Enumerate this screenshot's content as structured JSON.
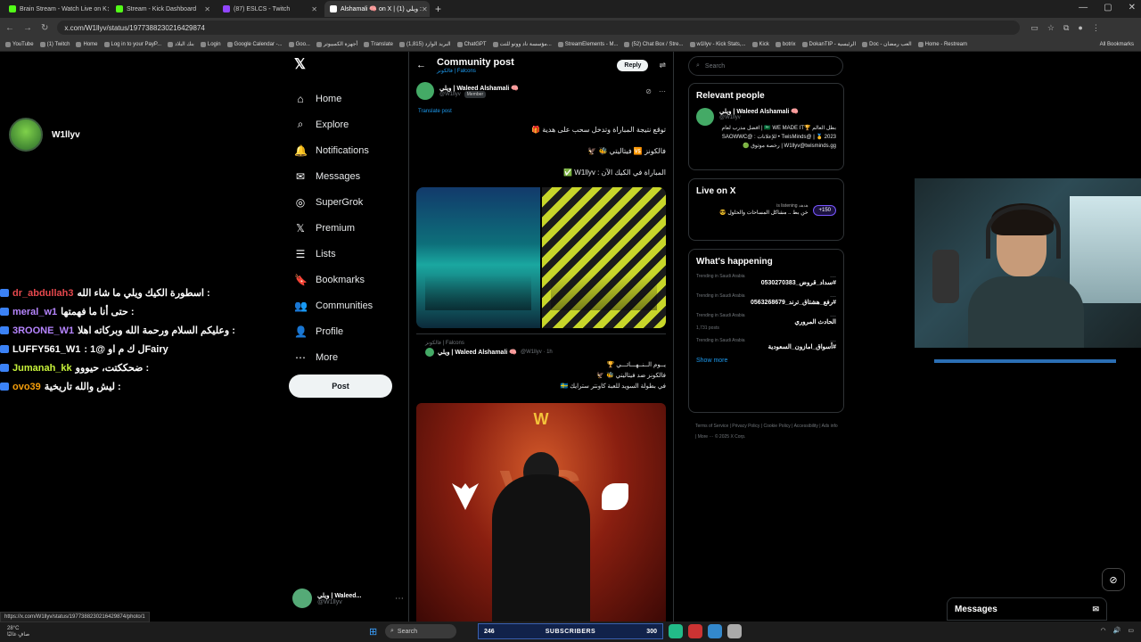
{
  "browser": {
    "tabs": [
      {
        "label": "Brain Stream - Watch Live on K",
        "color": "#53fc18"
      },
      {
        "label": "Stream - Kick Dashboard",
        "color": "#53fc18"
      },
      {
        "label": "(87) ESLCS - Twitch",
        "color": "#9146ff"
      },
      {
        "label": "Alshamali 🧠 on X | ويلي (1) :",
        "color": "#ffffff"
      }
    ],
    "url": "x.com/W1llyv/status/1977388230216429874",
    "bookmarks": [
      "YouTube",
      "(1) Twitch",
      "Home",
      "Log in to your PayP...",
      "بنك البلاد",
      "Login",
      "Google Calendar -...",
      "Goo...",
      "أجهزة الكمبيوتر",
      "Translate",
      "البريد الوارد (1,815)",
      "ChatGPT",
      "مؤسسة ناد ووتو للتت...",
      "StreamElements - M...",
      "(52) Chat Box / Stre...",
      "w1llyv - Kick Stats,...",
      "Kick",
      "botrix",
      "DokanTIP - الرئيسية",
      "Doc - العب رمضان",
      "Home - Restream"
    ],
    "all_bookmarks": "All Bookmarks"
  },
  "stream": {
    "streamer_name": "W1llyv",
    "chat": [
      {
        "user": "dr_abdullah3",
        "user_color": "#e5484d",
        "msg": "اسطورة الكيك ويلي ما شاء الله :"
      },
      {
        "user": "meral_w1",
        "user_color": "#b685ff",
        "msg": "حتى أنا ما فهمتها :"
      },
      {
        "user": "3ROONE_W1",
        "user_color": "#b685ff",
        "msg": "وعليكم السلام ورحمة الله وبركاته اهلا :"
      },
      {
        "user": "LUFFY561_W1",
        "user_color": "#ffffff",
        "msg": ": 1@ ل ك م اوFairy"
      },
      {
        "user": "Jumanah_kk",
        "user_color": "#c7f23a",
        "msg": "ضحككتت، حيووو :"
      },
      {
        "user": "ovo39",
        "user_color": "#f59e0b",
        "msg": "ليش والله تاريخية :"
      }
    ],
    "webcam_caption": ""
  },
  "x": {
    "nav": [
      {
        "label": "Home",
        "icon": "home-icon",
        "glyph": "⌂"
      },
      {
        "label": "Explore",
        "icon": "search-icon",
        "glyph": "⌕"
      },
      {
        "label": "Notifications",
        "icon": "bell-icon",
        "glyph": "🔔"
      },
      {
        "label": "Messages",
        "icon": "mail-icon",
        "glyph": "✉"
      },
      {
        "label": "SuperGrok",
        "icon": "grok-icon",
        "glyph": "◎"
      },
      {
        "label": "Premium",
        "icon": "x-icon",
        "glyph": "𝕏"
      },
      {
        "label": "Lists",
        "icon": "list-icon",
        "glyph": "☰"
      },
      {
        "label": "Bookmarks",
        "icon": "bookmark-icon",
        "glyph": "🔖"
      },
      {
        "label": "Communities",
        "icon": "people-icon",
        "glyph": "👥"
      },
      {
        "label": "Profile",
        "icon": "person-icon",
        "glyph": "👤"
      },
      {
        "label": "More",
        "icon": "more-icon",
        "glyph": "⋯"
      }
    ],
    "post_button": "Post",
    "account": {
      "name": "ويلي | Waleed...",
      "handle": "@W1llyv"
    },
    "header": {
      "title": "Community post",
      "subtitle": "فالكونز | Falcons",
      "reply": "Reply"
    },
    "post": {
      "author": "ويلي | Waleed Alshamali 🧠",
      "handle": "@W1llyv",
      "member": "Member",
      "translate": "Translate post",
      "lines": [
        "توقع نتيجة المباراة وتدخل سحب على هدية 🎁",
        "فالكونز 🆚 فيتاليتي 🐝 🦅",
        "المباراة في الكيك الآن : W1llyv ✅"
      ]
    },
    "quote": {
      "community": "فالكونز | Falcons",
      "author": "ويلي | Waleed Alshamali 🧠",
      "handle": "@W1llyv · 1h",
      "lines": [
        "يــوم الــنــهـــائـــي 🏆",
        "فالكونز ضد فيتاليتي 🐝 🦅",
        "في بطولة السويد للعبة كاونتر سترايك 🇸🇪"
      ]
    },
    "search_placeholder": "Search",
    "relevant": {
      "title": "Relevant people",
      "name": "ويلي | Waleed Alshamali 🧠",
      "handle": "@W1llyv",
      "bio": "بطل العالم 🏆🇸🇦 WE MADE IT | افضل مدرب لعام 2023 🥇 | @TwisMinds • للإعلانات : @SAOWWC | W1llyv@twisminds.gg رخصة موثوق 🟢"
    },
    "live": {
      "title": "Live on X",
      "host": "هدهد is listening",
      "text": "خن بط .. مشاكل المساحات والحلول 😎",
      "listeners": "+150"
    },
    "happening": {
      "title": "What's happening",
      "trends": [
        {
          "cat": "Trending in Saudi Arabia",
          "title": "#سداد_قروض_0530270383",
          "count": ""
        },
        {
          "cat": "Trending in Saudi Arabia",
          "title": "#رفع_هشتاق_ترند_0563268679",
          "count": ""
        },
        {
          "cat": "Trending in Saudi Arabia",
          "title": "الحادث المروري",
          "count": "1,731 posts"
        },
        {
          "cat": "Trending in Saudi Arabia",
          "title": "#أسواق_امازون_السعودية",
          "count": ""
        }
      ],
      "show_more": "Show more"
    },
    "footer": "Terms of Service | Privacy Policy | Cookie Policy | Accessibility | Ads info | More ··· © 2025 X Corp.",
    "messages_dock": "Messages"
  },
  "overlay": {
    "subs_left": "246",
    "subs_label": "SUBSCRIBERS",
    "subs_right": "300"
  },
  "taskbar": {
    "temp": "28°C",
    "weather": "صافٍ غالبًا",
    "search": "Search"
  },
  "status_url": "https://x.com/W1llyv/status/1977388230216429874/photo/1"
}
